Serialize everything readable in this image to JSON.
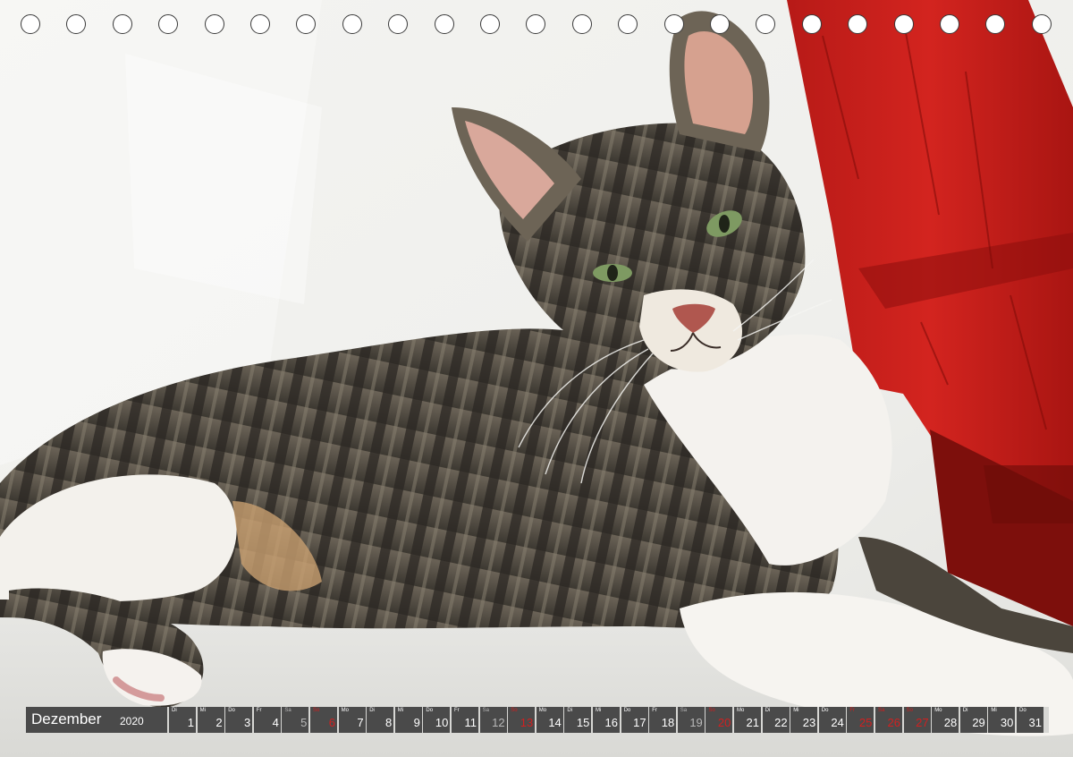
{
  "calendar": {
    "month": "Dezember",
    "year": "2020",
    "days": [
      {
        "wd": "Di",
        "num": "1",
        "type": "work"
      },
      {
        "wd": "Mi",
        "num": "2",
        "type": "work"
      },
      {
        "wd": "Do",
        "num": "3",
        "type": "work"
      },
      {
        "wd": "Fr",
        "num": "4",
        "type": "work"
      },
      {
        "wd": "Sa",
        "num": "5",
        "type": "sat"
      },
      {
        "wd": "So",
        "num": "6",
        "type": "sun"
      },
      {
        "wd": "Mo",
        "num": "7",
        "type": "work"
      },
      {
        "wd": "Di",
        "num": "8",
        "type": "work"
      },
      {
        "wd": "Mi",
        "num": "9",
        "type": "work"
      },
      {
        "wd": "Do",
        "num": "10",
        "type": "work"
      },
      {
        "wd": "Fr",
        "num": "11",
        "type": "work"
      },
      {
        "wd": "Sa",
        "num": "12",
        "type": "sat"
      },
      {
        "wd": "So",
        "num": "13",
        "type": "sun"
      },
      {
        "wd": "Mo",
        "num": "14",
        "type": "work"
      },
      {
        "wd": "Di",
        "num": "15",
        "type": "work"
      },
      {
        "wd": "Mi",
        "num": "16",
        "type": "work"
      },
      {
        "wd": "Do",
        "num": "17",
        "type": "work"
      },
      {
        "wd": "Fr",
        "num": "18",
        "type": "work"
      },
      {
        "wd": "Sa",
        "num": "19",
        "type": "sat"
      },
      {
        "wd": "So",
        "num": "20",
        "type": "sun"
      },
      {
        "wd": "Mo",
        "num": "21",
        "type": "work"
      },
      {
        "wd": "Di",
        "num": "22",
        "type": "work"
      },
      {
        "wd": "Mi",
        "num": "23",
        "type": "work"
      },
      {
        "wd": "Do",
        "num": "24",
        "type": "work"
      },
      {
        "wd": "Fr",
        "num": "25",
        "type": "hol"
      },
      {
        "wd": "Sa",
        "num": "26",
        "type": "hol"
      },
      {
        "wd": "So",
        "num": "27",
        "type": "sun"
      },
      {
        "wd": "Mo",
        "num": "28",
        "type": "work"
      },
      {
        "wd": "Di",
        "num": "29",
        "type": "work"
      },
      {
        "wd": "Mi",
        "num": "30",
        "type": "work"
      },
      {
        "wd": "Do",
        "num": "31",
        "type": "work"
      }
    ]
  },
  "binding_hole_count": 23,
  "colors": {
    "calendar_bar": "#4a4a4a",
    "holiday_red": "#d21f1f",
    "bench_red": "#c8201c",
    "wall_white": "#f2f2ef"
  },
  "photo": {
    "icon": "tabby-cat-photo-icon"
  }
}
